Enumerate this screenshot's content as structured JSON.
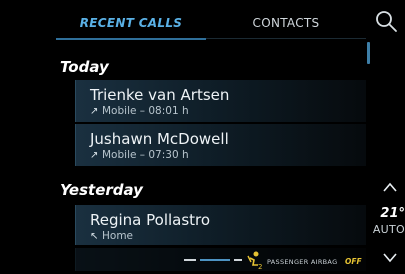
{
  "tabs": {
    "recent_calls": "RECENT CALLS",
    "contacts": "CONTACTS"
  },
  "search_icon": "search-icon",
  "sections": {
    "today": "Today",
    "yesterday": "Yesterday"
  },
  "calls": [
    {
      "name": "Trienke van Artsen",
      "detail": "Mobile – 08:01 h",
      "direction": "outgoing",
      "arrow_icon": "outgoing-call-arrow-icon"
    },
    {
      "name": "Jushawn McDowell",
      "detail": "Mobile – 07:30 h",
      "direction": "outgoing",
      "arrow_icon": "outgoing-call-arrow-icon"
    },
    {
      "name": "Regina Pollastro",
      "detail": "Home",
      "direction": "incoming",
      "arrow_icon": "incoming-call-arrow-icon"
    }
  ],
  "climate": {
    "temperature": "21°",
    "mode": "AUTO"
  },
  "status_bar": {
    "airbag_label": "PASSENGER AIRBAG",
    "airbag_status": "OFF",
    "airbag_icon": "passenger-airbag-icon"
  },
  "colors": {
    "accent": "#5ab1e6",
    "background": "#000000",
    "airbag_off": "#e6c333"
  }
}
